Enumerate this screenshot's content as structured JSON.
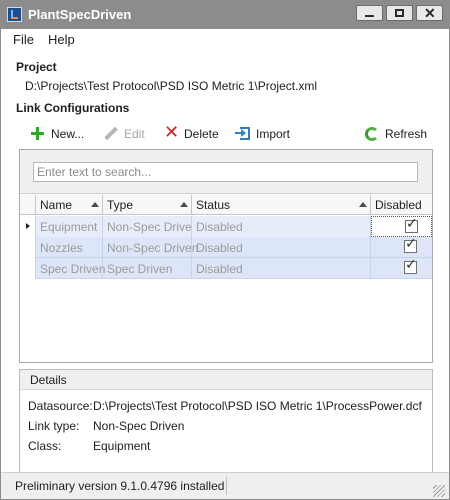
{
  "window": {
    "title": "PlantSpecDriven",
    "minimize_label": "▁",
    "maximize_label": "□",
    "close_label": "✕"
  },
  "menu": {
    "file": "File",
    "help": "Help"
  },
  "project": {
    "section_title": "Project",
    "path": "D:\\Projects\\Test Protocol\\PSD ISO Metric 1\\Project.xml"
  },
  "link_configurations": {
    "section_title": "Link Configurations",
    "toolbar": {
      "new_label": "New...",
      "edit_label": "Edit",
      "delete_label": "Delete",
      "import_label": "Import",
      "refresh_label": "Refresh"
    },
    "search": {
      "placeholder": "Enter text to search..."
    },
    "columns": {
      "name": "Name",
      "type": "Type",
      "status": "Status",
      "disabled": "Disabled"
    },
    "rows": [
      {
        "name": "Equipment",
        "type": "Non-Spec Driven",
        "status": "Disabled",
        "disabled": true,
        "selected": true
      },
      {
        "name": "Nozzles",
        "type": "Non-Spec Driven",
        "status": "Disabled",
        "disabled": true,
        "selected": false
      },
      {
        "name": "Spec Driven",
        "type": "Spec Driven",
        "status": "Disabled",
        "disabled": true,
        "selected": false
      }
    ]
  },
  "details": {
    "section_title": "Details",
    "datasource_label": "Datasource:",
    "datasource_value": "D:\\Projects\\Test Protocol\\PSD ISO Metric 1\\ProcessPower.dcf",
    "link_type_label": "Link type:",
    "link_type_value": "Non-Spec Driven",
    "class_label": "Class:",
    "class_value": "Equipment"
  },
  "status_bar": {
    "text": "Preliminary version 9.1.0.4796 installed"
  },
  "colors": {
    "title_bar": "#8c8c8c",
    "row_background": "#dde6f8",
    "new_icon": "#2ea829",
    "delete_icon": "#d9201c",
    "import_icon": "#2d7fc9",
    "refresh_icon": "#52b043"
  },
  "icons": {
    "app": "app-icon",
    "new": "plus-icon",
    "edit": "pencil-icon",
    "delete": "x-icon",
    "import": "import-icon",
    "refresh": "refresh-icon"
  }
}
